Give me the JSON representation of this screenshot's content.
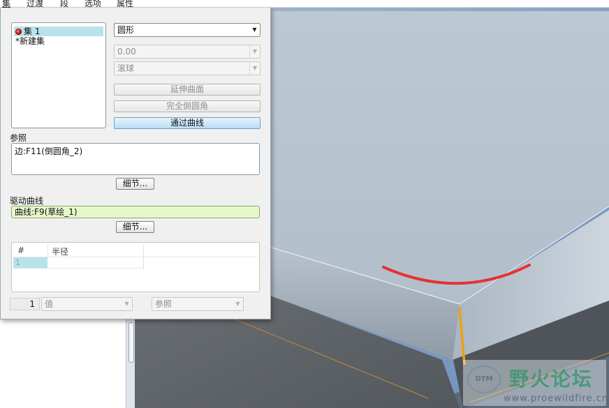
{
  "top_tabs": [
    "集",
    "过渡",
    "段",
    "选项",
    "属性"
  ],
  "sets": {
    "items": [
      {
        "label": "集 1",
        "selected": true
      },
      {
        "label": "*新建集",
        "selected": false
      }
    ]
  },
  "shape": {
    "value": "圆形",
    "radius_value": "0.00",
    "method_value": "滚球"
  },
  "buttons": {
    "extend_surface": "延伸曲面",
    "full_round": "完全倒圆角",
    "through_curve": "通过曲线",
    "details_1": "细节...",
    "details_2": "细节..."
  },
  "references": {
    "label": "参照",
    "value": "边:F11(倒圆角_2)"
  },
  "driving_curve": {
    "label": "驱动曲线",
    "value": "曲线:F9(草绘_1)"
  },
  "radius_table": {
    "columns": [
      "#",
      "半径"
    ],
    "rows": [
      {
        "num": "1",
        "radius": ""
      }
    ]
  },
  "bottom_bar": {
    "count": "1",
    "value_placeholder": "值",
    "reference_placeholder": "参照"
  },
  "watermark": {
    "site_name": "野火论坛",
    "url": "www.proewildfire.cn",
    "logo_text": "DTM"
  },
  "colors": {
    "curve_red": "#e83030",
    "edge_orange": "#f0a010",
    "model_surface": "#b7c3cf",
    "selected_button": "#b9dcf6",
    "driving_curve_field": "#e6f7c9"
  }
}
